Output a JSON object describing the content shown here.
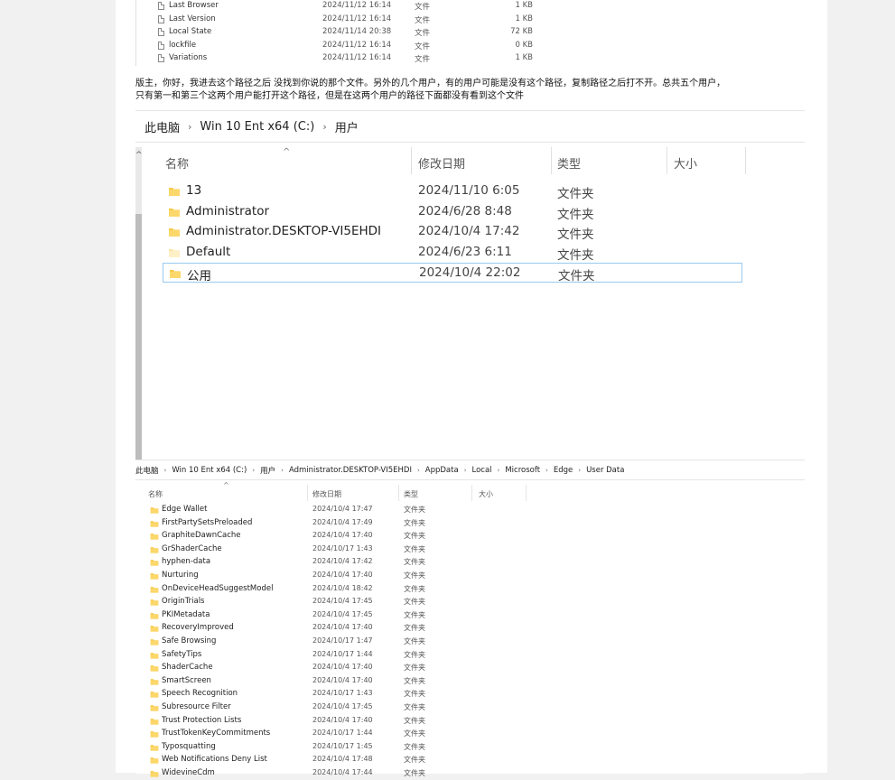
{
  "top_files": [
    {
      "name": "Last Browser",
      "date": "2024/11/12 16:14",
      "type": "文件",
      "size": "1 KB"
    },
    {
      "name": "Last Version",
      "date": "2024/11/12 16:14",
      "type": "文件",
      "size": "1 KB"
    },
    {
      "name": "Local State",
      "date": "2024/11/14 20:38",
      "type": "文件",
      "size": "72 KB"
    },
    {
      "name": "lockfile",
      "date": "2024/11/12 16:14",
      "type": "文件",
      "size": "0 KB"
    },
    {
      "name": "Variations",
      "date": "2024/11/12 16:14",
      "type": "文件",
      "size": "1 KB"
    }
  ],
  "message": {
    "line1": "版主，你好，我进去这个路径之后 没找到你说的那个文件。另外的几个用户，有的用户可能是没有这个路径，复制路径之后打不开。总共五个用户，",
    "line2": "只有第一和第三个这两个用户能打开这个路径，但是在这两个用户的路径下面都没有看到这个文件"
  },
  "explorer1": {
    "breadcrumb": [
      "此电脑",
      "Win 10 Ent x64 (C:)",
      "用户"
    ],
    "separator": "›",
    "sort_indicator": "^",
    "scroll_up": "^",
    "headers": {
      "name": "名称",
      "date": "修改日期",
      "type": "类型",
      "size": "大小"
    },
    "rows": [
      {
        "name": "13",
        "date": "2024/11/10 6:05",
        "type": "文件夹"
      },
      {
        "name": "Administrator",
        "date": "2024/6/28 8:48",
        "type": "文件夹"
      },
      {
        "name": "Administrator.DESKTOP-VI5EHDI",
        "date": "2024/10/4 17:42",
        "type": "文件夹"
      },
      {
        "name": "Default",
        "date": "2024/6/23 6:11",
        "type": "文件夹"
      },
      {
        "name": "公用",
        "date": "2024/10/4 22:02",
        "type": "文件夹"
      }
    ]
  },
  "explorer2": {
    "breadcrumb": [
      "此电脑",
      "Win 10 Ent x64 (C:)",
      "用户",
      "Administrator.DESKTOP-VI5EHDI",
      "AppData",
      "Local",
      "Microsoft",
      "Edge",
      "User Data"
    ],
    "separator": "›",
    "sort_indicator": "^",
    "headers": {
      "name": "名称",
      "date": "修改日期",
      "type": "类型",
      "size": "大小"
    },
    "rows": [
      {
        "name": "Edge Wallet",
        "date": "2024/10/4 17:47",
        "type": "文件夹"
      },
      {
        "name": "FirstPartySetsPreloaded",
        "date": "2024/10/4 17:49",
        "type": "文件夹"
      },
      {
        "name": "GraphiteDawnCache",
        "date": "2024/10/4 17:40",
        "type": "文件夹"
      },
      {
        "name": "GrShaderCache",
        "date": "2024/10/17 1:43",
        "type": "文件夹"
      },
      {
        "name": "hyphen-data",
        "date": "2024/10/4 17:42",
        "type": "文件夹"
      },
      {
        "name": "Nurturing",
        "date": "2024/10/4 17:40",
        "type": "文件夹"
      },
      {
        "name": "OnDeviceHeadSuggestModel",
        "date": "2024/10/4 18:42",
        "type": "文件夹"
      },
      {
        "name": "OriginTrials",
        "date": "2024/10/4 17:45",
        "type": "文件夹"
      },
      {
        "name": "PKIMetadata",
        "date": "2024/10/4 17:45",
        "type": "文件夹"
      },
      {
        "name": "RecoveryImproved",
        "date": "2024/10/4 17:40",
        "type": "文件夹"
      },
      {
        "name": "Safe Browsing",
        "date": "2024/10/17 1:47",
        "type": "文件夹"
      },
      {
        "name": "SafetyTips",
        "date": "2024/10/17 1:44",
        "type": "文件夹"
      },
      {
        "name": "ShaderCache",
        "date": "2024/10/4 17:40",
        "type": "文件夹"
      },
      {
        "name": "SmartScreen",
        "date": "2024/10/4 17:40",
        "type": "文件夹"
      },
      {
        "name": "Speech Recognition",
        "date": "2024/10/17 1:43",
        "type": "文件夹"
      },
      {
        "name": "Subresource Filter",
        "date": "2024/10/4 17:45",
        "type": "文件夹"
      },
      {
        "name": "Trust Protection Lists",
        "date": "2024/10/4 17:40",
        "type": "文件夹"
      },
      {
        "name": "TrustTokenKeyCommitments",
        "date": "2024/10/17 1:44",
        "type": "文件夹"
      },
      {
        "name": "Typosquatting",
        "date": "2024/10/17 1:45",
        "type": "文件夹"
      },
      {
        "name": "Web Notifications Deny List",
        "date": "2024/10/4 17:48",
        "type": "文件夹"
      },
      {
        "name": "WidevineCdm",
        "date": "2024/10/4 17:44",
        "type": "文件夹"
      }
    ]
  },
  "colors": {
    "folder": "#f7c948",
    "folder_dark": "#e0a92a",
    "selection_border": "#99c9ef"
  }
}
